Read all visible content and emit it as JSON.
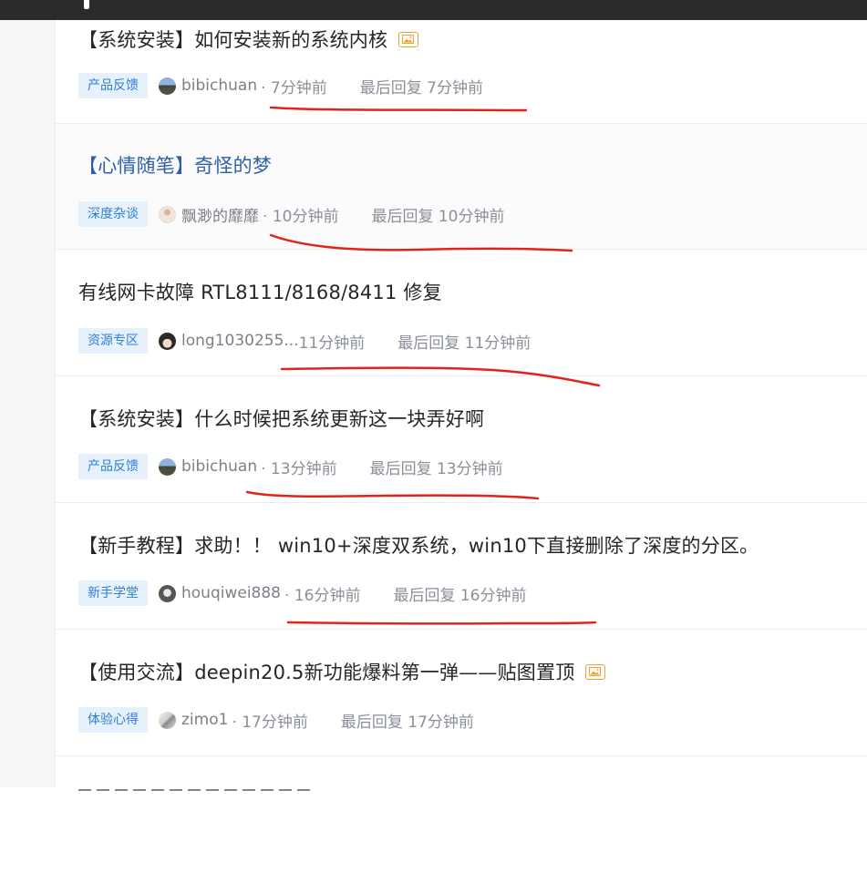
{
  "posts": [
    {
      "title": "【系统安装】如何安装新的系统内核",
      "has_image_icon": true,
      "category": "产品反馈",
      "author": "bibichuan",
      "time": "· 7分钟前",
      "last_reply": "最后回复 7分钟前",
      "avatar": "landscape-avatar"
    },
    {
      "title": "【心情随笔】奇怪的梦",
      "has_image_icon": false,
      "category": "深度杂谈",
      "author": "飘渺的靡靡",
      "time": "· 10分钟前",
      "last_reply": "最后回复 10分钟前",
      "avatar": "figure-avatar"
    },
    {
      "title": "有线网卡故障 RTL8111/8168/8411 修复",
      "has_image_icon": false,
      "category": "资源专区",
      "author": "long1030255...",
      "time": "11分钟前",
      "last_reply": "最后回复 11分钟前",
      "avatar": "face-avatar"
    },
    {
      "title": "【系统安装】什么时候把系统更新这一块弄好啊",
      "has_image_icon": false,
      "category": "产品反馈",
      "author": "bibichuan",
      "time": "· 13分钟前",
      "last_reply": "最后回复 13分钟前",
      "avatar": "landscape-avatar"
    },
    {
      "title": "【新手教程】求助！！ win10+深度双系统，win10下直接删除了深度的分区。",
      "has_image_icon": false,
      "category": "新手学堂",
      "author": "houqiwei888",
      "time": "· 16分钟前",
      "last_reply": "最后回复 16分钟前",
      "avatar": "person-avatar"
    },
    {
      "title": "【使用交流】deepin20.5新功能爆料第一弹——贴图置顶",
      "has_image_icon": true,
      "category": "体验心得",
      "author": "zimo1",
      "time": "· 17分钟前",
      "last_reply": "最后回复 17分钟前",
      "avatar": "feather-avatar"
    }
  ],
  "colors": {
    "accent_link": "#2f5fa7",
    "badge_bg": "#e6f1fc",
    "badge_text": "#2f7fd6",
    "annotation_red": "#e0241b",
    "topbar": "#2b2b2b"
  }
}
